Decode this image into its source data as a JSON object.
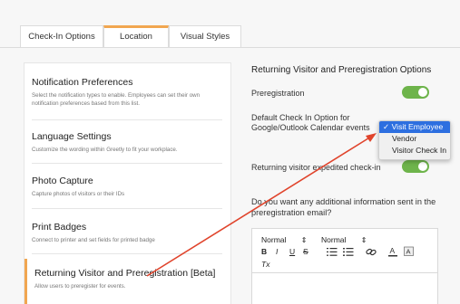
{
  "tabs": [
    {
      "label": "Check-In Options"
    },
    {
      "label": "Location"
    },
    {
      "label": "Visual Styles"
    }
  ],
  "settings": [
    {
      "title": "Notification Preferences",
      "desc": "Select the notification types to enable. Employees can set their own notification preferences based from this list."
    },
    {
      "title": "Language Settings",
      "desc": "Customize the wording within Greetly to fit your workplace."
    },
    {
      "title": "Photo Capture",
      "desc": "Capture photos of visitors or their IDs"
    },
    {
      "title": "Print Badges",
      "desc": "Connect to printer and set fields for printed badge"
    },
    {
      "title": "Returning Visitor and Preregistration [Beta]",
      "desc": "Allow users to preregister for events."
    }
  ],
  "right": {
    "heading": "Returning Visitor and Preregistration Options",
    "prereg_label": "Preregistration",
    "prereg_enabled": true,
    "default_label": "Default Check In Option for Google/Outlook Calendar events",
    "expedited_label": "Returning visitor expedited check-in",
    "expedited_enabled": true,
    "question": "Do you want any additional information sent in the preregistration email?"
  },
  "dropdown": {
    "options": [
      "Visit Employee",
      "Vendor",
      "Visitor Check In"
    ],
    "selected": "Visit Employee",
    "check": "✓"
  },
  "editor": {
    "style_select": "Normal",
    "size_select": "Normal",
    "select_arrow": "⇕",
    "bold": "B",
    "italic": "I",
    "underline": "U",
    "strike": "S",
    "clear": "Tx"
  },
  "colors": {
    "accent": "#f1a650",
    "toggle_on": "#6eb44b",
    "arrow": "#e0442c",
    "dropdown_selected": "#2d6fe0"
  }
}
